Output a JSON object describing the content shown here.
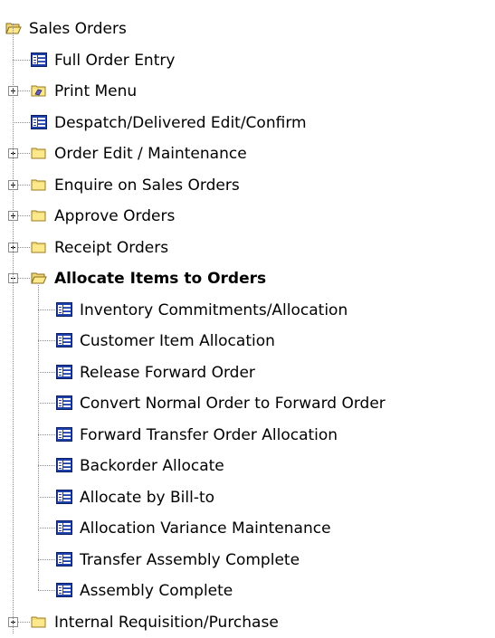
{
  "tree": {
    "root": {
      "label": "Sales Orders",
      "expanded": true,
      "icon": "folder-open-icon"
    },
    "items": [
      {
        "label": "Full Order Entry",
        "type": "program",
        "icon": "program-icon"
      },
      {
        "label": "Print Menu",
        "type": "folder",
        "expanded": false,
        "icon": "print-folder-icon"
      },
      {
        "label": "Despatch/Delivered Edit/Confirm",
        "type": "program",
        "icon": "program-icon"
      },
      {
        "label": "Order Edit / Maintenance",
        "type": "folder",
        "expanded": false,
        "icon": "folder-icon"
      },
      {
        "label": "Enquire on Sales Orders",
        "type": "folder",
        "expanded": false,
        "icon": "folder-icon"
      },
      {
        "label": "Approve Orders",
        "type": "folder",
        "expanded": false,
        "icon": "folder-icon"
      },
      {
        "label": "Receipt Orders",
        "type": "folder",
        "expanded": false,
        "icon": "folder-icon"
      },
      {
        "label": "Allocate Items to Orders",
        "type": "folder",
        "expanded": true,
        "selected": true,
        "icon": "folder-open-icon",
        "children": [
          {
            "label": "Inventory Commitments/Allocation",
            "type": "program",
            "icon": "program-icon"
          },
          {
            "label": "Customer Item Allocation",
            "type": "program",
            "icon": "program-icon"
          },
          {
            "label": "Release Forward Order",
            "type": "program",
            "icon": "program-icon"
          },
          {
            "label": "Convert Normal Order to Forward Order",
            "type": "program",
            "icon": "program-icon"
          },
          {
            "label": "Forward Transfer Order Allocation",
            "type": "program",
            "icon": "program-icon"
          },
          {
            "label": "Backorder Allocate",
            "type": "program",
            "icon": "program-icon"
          },
          {
            "label": "Allocate by Bill-to",
            "type": "program",
            "icon": "program-icon"
          },
          {
            "label": "Allocation Variance Maintenance",
            "type": "program",
            "icon": "program-icon"
          },
          {
            "label": "Transfer Assembly Complete",
            "type": "program",
            "icon": "program-icon"
          },
          {
            "label": "Assembly Complete",
            "type": "program",
            "icon": "program-icon"
          }
        ]
      },
      {
        "label": "Internal Requisition/Purchase",
        "type": "folder",
        "expanded": false,
        "icon": "folder-icon"
      }
    ]
  }
}
